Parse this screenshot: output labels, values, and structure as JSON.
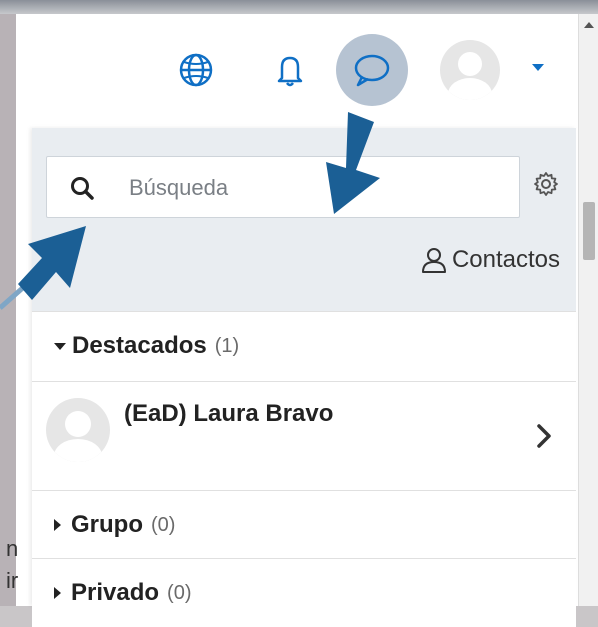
{
  "nav": {
    "icons": [
      "globe-icon",
      "bell-icon",
      "message-icon",
      "avatar",
      "caret-down-icon"
    ]
  },
  "drawer": {
    "search_placeholder": "Búsqueda",
    "contacts_label": "Contactos",
    "sections": [
      {
        "label": "Destacados",
        "count": "(1)"
      },
      {
        "label": "Grupo",
        "count": "(0)"
      },
      {
        "label": "Privado",
        "count": "(0)"
      }
    ],
    "starred_contact": "(EaD) Laura Bravo"
  },
  "background_text": {
    "line1": "n",
    "line2": "ir"
  },
  "colors": {
    "accent": "#0f6fc5",
    "arrow": "#1b5f95",
    "drawer_header": "#e9edf1"
  }
}
